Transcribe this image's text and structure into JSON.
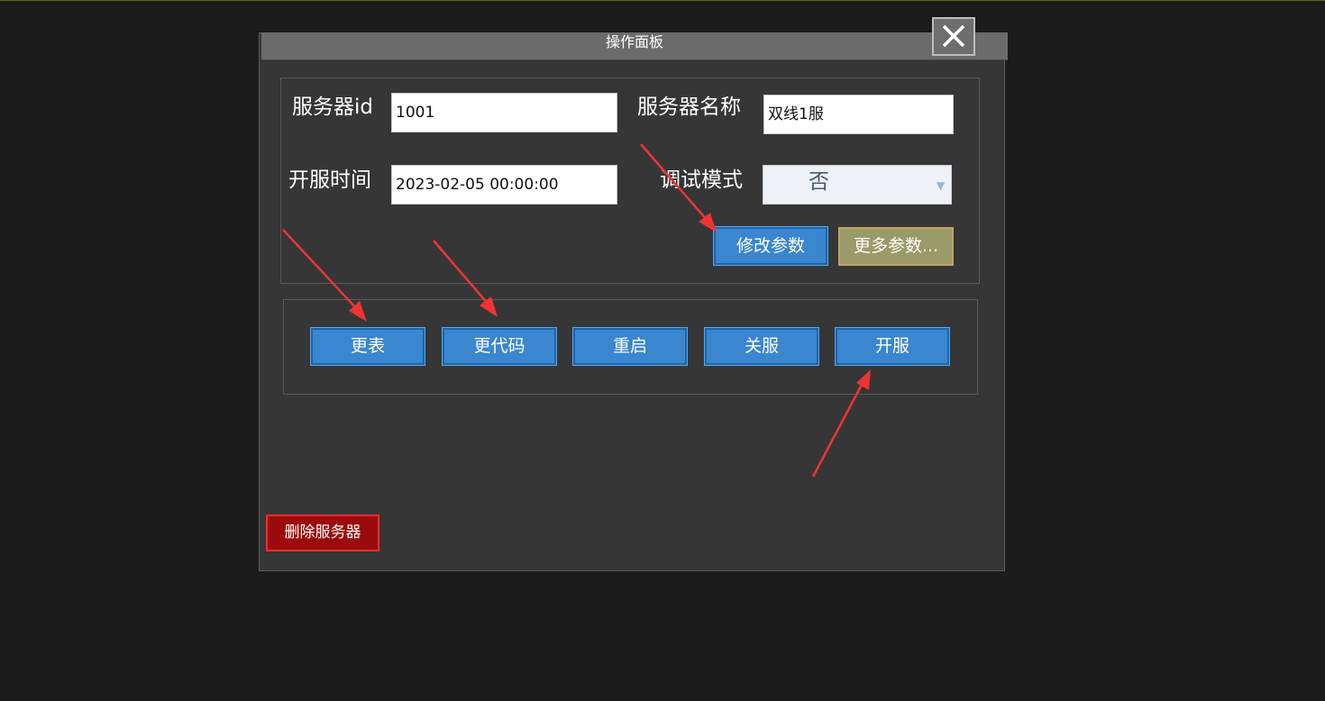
{
  "panel": {
    "title": "操作面板",
    "close_icon": "close-icon"
  },
  "params": {
    "server_id_label": "服务器id",
    "server_id_value": "1001",
    "server_name_label": "服务器名称",
    "server_name_value": "双线1服",
    "open_time_label": "开服时间",
    "open_time_value": "2023-02-05 00:00:00",
    "debug_mode_label": "调试模式",
    "debug_mode_value": "否",
    "debug_mode_caret": "▼",
    "modify_params_label": "修改参数",
    "more_params_label": "更多参数..."
  },
  "actions": {
    "update_table_label": "更表",
    "update_code_label": "更代码",
    "restart_label": "重启",
    "shutdown_label": "关服",
    "start_label": "开服"
  },
  "danger": {
    "delete_server_label": "删除服务器"
  },
  "colors": {
    "background": "#1b1b1b",
    "panel": "#363636",
    "title_bar": "#6b6b6b",
    "button_blue": "#3a86cf",
    "button_khaki": "#9a9b69",
    "button_danger": "#9b0b0b",
    "annotation_arrow": "#ee3434"
  }
}
